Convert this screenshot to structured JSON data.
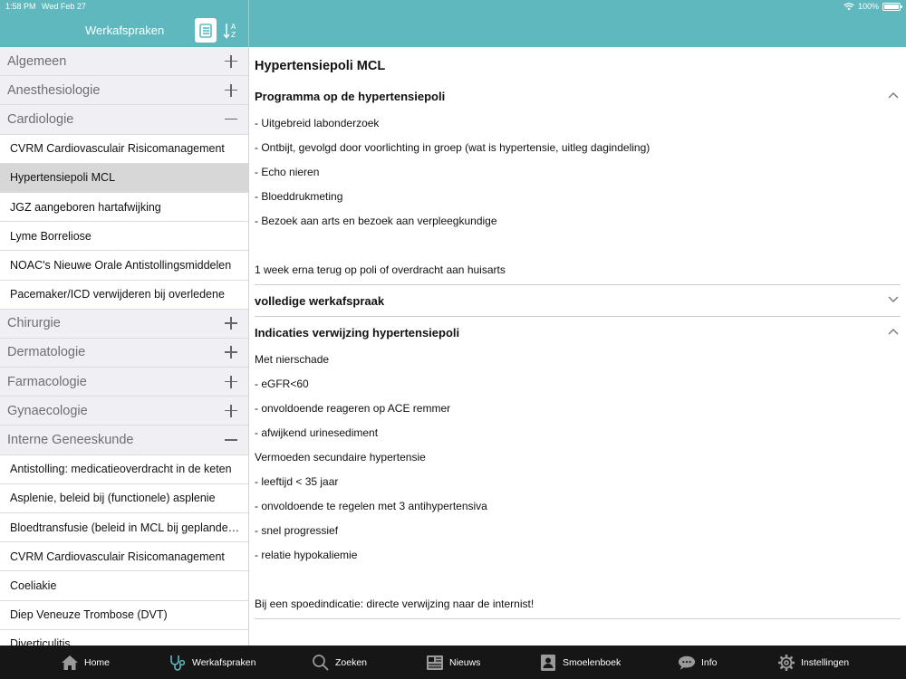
{
  "status": {
    "time": "1:58 PM",
    "date": "Wed Feb 27",
    "battery": "100%"
  },
  "header": {
    "title": "Werkafspraken"
  },
  "colors": {
    "teal": "#5fb8bd",
    "tabbar": "#161616",
    "selected": "#d7d7d7",
    "category_bg": "#efeff4"
  },
  "sidebar": {
    "rows": [
      {
        "type": "cat",
        "label": "Algemeen",
        "expanded": false
      },
      {
        "type": "cat",
        "label": "Anesthesiologie",
        "expanded": false
      },
      {
        "type": "cat",
        "label": "Cardiologie",
        "expanded": true
      },
      {
        "type": "item",
        "label": "CVRM Cardiovasculair Risicomanagement"
      },
      {
        "type": "item",
        "label": "Hypertensiepoli MCL",
        "selected": true
      },
      {
        "type": "item",
        "label": "JGZ aangeboren hartafwijking"
      },
      {
        "type": "item",
        "label": "Lyme Borreliose"
      },
      {
        "type": "item",
        "label": "NOAC's Nieuwe Orale Antistollingsmiddelen"
      },
      {
        "type": "item",
        "label": "Pacemaker/ICD verwijderen bij overledene"
      },
      {
        "type": "cat",
        "label": "Chirurgie",
        "expanded": false
      },
      {
        "type": "cat",
        "label": "Dermatologie",
        "expanded": false
      },
      {
        "type": "cat",
        "label": "Farmacologie",
        "expanded": false
      },
      {
        "type": "cat",
        "label": "Gynaecologie",
        "expanded": false
      },
      {
        "type": "cat",
        "label": "Interne Geneeskunde",
        "expanded": true
      },
      {
        "type": "item",
        "label": "Antistolling: medicatieoverdracht in de keten"
      },
      {
        "type": "item",
        "label": "Asplenie,  beleid bij (functionele) asplenie"
      },
      {
        "type": "item",
        "label": "Bloedtransfusie (beleid in MCL bij geplande ingrepen)"
      },
      {
        "type": "item",
        "label": "CVRM Cardiovasculair Risicomanagement"
      },
      {
        "type": "item",
        "label": "Coeliakie"
      },
      {
        "type": "item",
        "label": "Diep Veneuze Trombose (DVT)"
      },
      {
        "type": "item",
        "label": "Diverticulitis"
      }
    ]
  },
  "main": {
    "title": "Hypertensiepoli MCL",
    "sections": [
      {
        "heading": "Programma op de hypertensiepoli",
        "expanded": true,
        "lines": [
          "- Uitgebreid labonderzoek",
          "- Ontbijt, gevolgd door voorlichting in groep (wat is hypertensie, uitleg dagindeling)",
          "- Echo nieren",
          "- Bloeddrukmeting",
          "- Bezoek aan arts en bezoek aan verpleegkundige",
          "",
          "1 week erna terug op poli of overdracht aan huisarts"
        ]
      },
      {
        "heading": "volledige werkafspraak",
        "expanded": false,
        "lines": []
      },
      {
        "heading": "Indicaties verwijzing hypertensiepoli",
        "expanded": true,
        "lines": [
          "Met nierschade",
          "- eGFR<60",
          "- onvoldoende reageren op ACE remmer",
          "- afwijkend urinesediment",
          "Vermoeden secundaire hypertensie",
          "- leeftijd < 35 jaar",
          "- onvoldoende te regelen met 3 antihypertensiva",
          "- snel progressief",
          "- relatie hypokaliemie",
          "",
          "Bij een spoedindicatie: directe verwijzing naar de internist!"
        ]
      }
    ]
  },
  "tabbar": {
    "tabs": [
      {
        "label": "Home",
        "icon": "home-icon"
      },
      {
        "label": "Werkafspraken",
        "icon": "stethoscope-icon",
        "active": true
      },
      {
        "label": "Zoeken",
        "icon": "search-icon"
      },
      {
        "label": "Nieuws",
        "icon": "newspaper-icon"
      },
      {
        "label": "Smoelenboek",
        "icon": "person-book-icon"
      },
      {
        "label": "Info",
        "icon": "chat-bubble-icon"
      },
      {
        "label": "Instellingen",
        "icon": "gear-icon"
      }
    ]
  }
}
